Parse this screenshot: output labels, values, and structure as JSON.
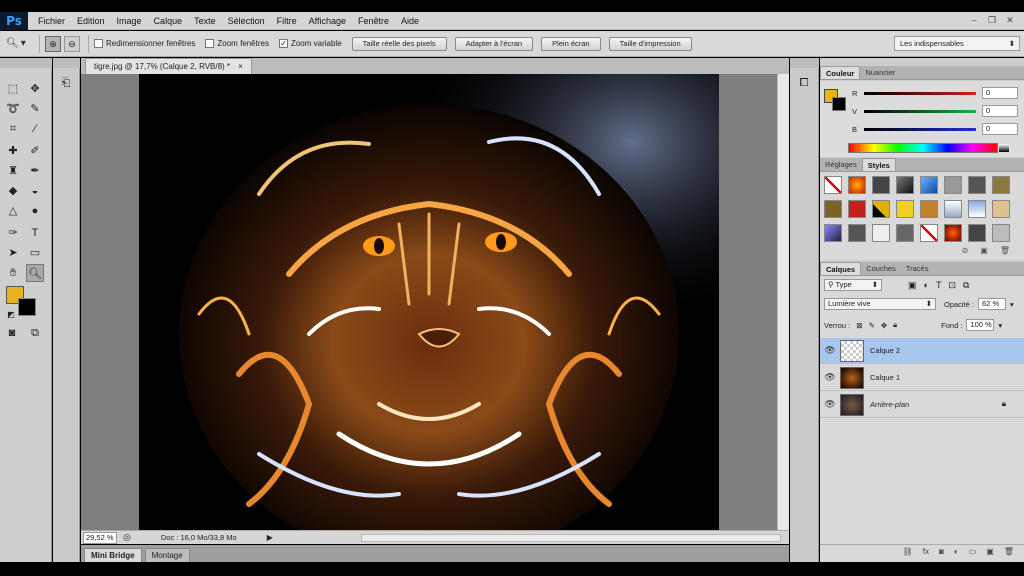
{
  "app": {
    "logo": "Ps"
  },
  "menu": [
    "Fichier",
    "Edition",
    "Image",
    "Calque",
    "Texte",
    "Sélection",
    "Filtre",
    "Affichage",
    "Fenêtre",
    "Aide"
  ],
  "window_controls": {
    "minimize": "–",
    "restore": "❐",
    "close": "✕"
  },
  "options": {
    "checkbox_resize": "Redimensionner fenêtres",
    "checkbox_zoom_all": "Zoom fenêtres",
    "checkbox_scrubby": "Zoom variable",
    "btn_actual": "Taille réelle des pixels",
    "btn_fit": "Adapter à l'écran",
    "btn_fill": "Plein écran",
    "btn_print": "Taille d'impression",
    "workspace": "Les indispensables"
  },
  "document": {
    "tab_title": "tigre.jpg @ 17,7% (Calque 2, RVB/8) *",
    "zoom": "29,52 %",
    "doc_info": "Doc : 16,0 Mo/33,8 Mo"
  },
  "bottom_tabs": [
    "Mini Bridge",
    "Montage"
  ],
  "color_panel": {
    "tabs": [
      "Couleur",
      "Nuancier"
    ],
    "channels": [
      {
        "label": "R",
        "value": "0",
        "color": "#d12020"
      },
      {
        "label": "V",
        "value": "0",
        "color": "#20b040"
      },
      {
        "label": "B",
        "value": "0",
        "color": "#2030d0"
      }
    ],
    "foreground": "#e8b21a",
    "background": "#000000"
  },
  "styles_panel": {
    "tabs": [
      "Réglages",
      "Styles"
    ]
  },
  "layers_panel": {
    "tabs": [
      "Calques",
      "Couches",
      "Tracés"
    ],
    "filter": "Type",
    "blend_mode": "Lumière vive",
    "opacity_label": "Opacité :",
    "opacity": "62 %",
    "lock_label": "Verrou :",
    "fill_label": "Fond :",
    "fill": "100 %",
    "layers": [
      {
        "name": "Calque 2",
        "selected": true
      },
      {
        "name": "Calque 1",
        "selected": false
      },
      {
        "name": "Arrière-plan",
        "selected": false,
        "locked": true
      }
    ]
  }
}
